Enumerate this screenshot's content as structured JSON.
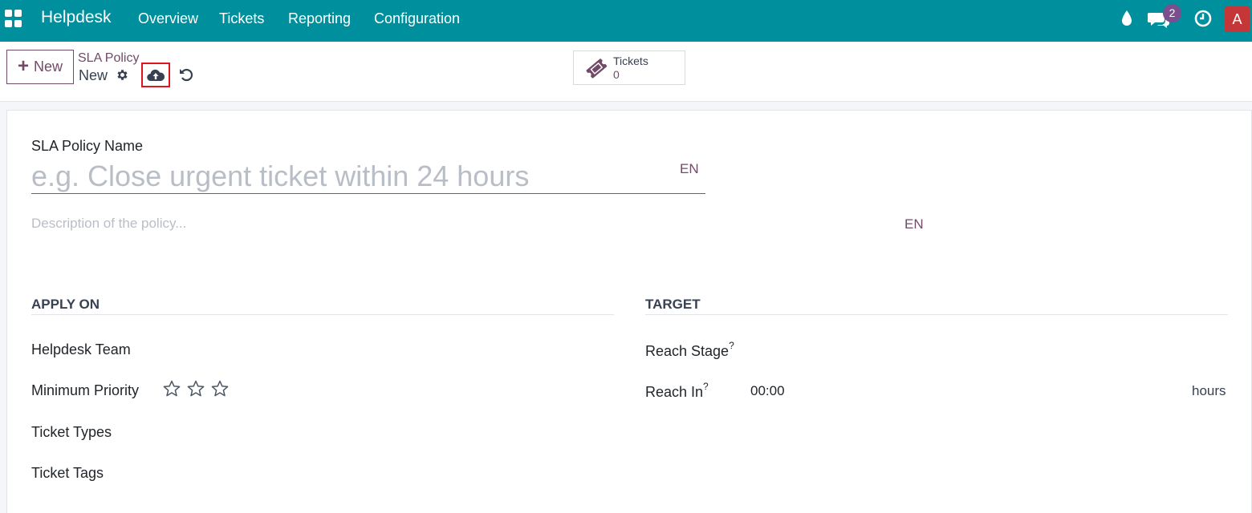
{
  "navbar": {
    "brand": "Helpdesk",
    "menu": [
      "Overview",
      "Tickets",
      "Reporting",
      "Configuration"
    ],
    "messages_count": "2",
    "avatar_letter": "A"
  },
  "control": {
    "new_label": "New",
    "breadcrumb_parent": "SLA Policy",
    "breadcrumb_current": "New",
    "smart_button": {
      "label": "Tickets",
      "value": "0"
    }
  },
  "form": {
    "name_label": "SLA Policy Name",
    "name_placeholder": "e.g. Close urgent ticket within 24 hours",
    "name_lang": "EN",
    "description_placeholder": "Description of the policy...",
    "description_lang": "EN",
    "apply_on": {
      "title": "APPLY ON",
      "helpdesk_team": "Helpdesk Team",
      "minimum_priority": "Minimum Priority",
      "priority_stars": 3,
      "ticket_types": "Ticket Types",
      "ticket_tags": "Ticket Tags"
    },
    "target": {
      "title": "TARGET",
      "reach_stage": "Reach Stage",
      "reach_in": "Reach In",
      "help_mark": "?",
      "reach_in_value": "00:00",
      "reach_in_unit": "hours"
    }
  },
  "colors": {
    "navbar": "#008f9c",
    "accent": "#714b67",
    "highlight_border": "#e0141e",
    "avatar": "#c53638"
  }
}
